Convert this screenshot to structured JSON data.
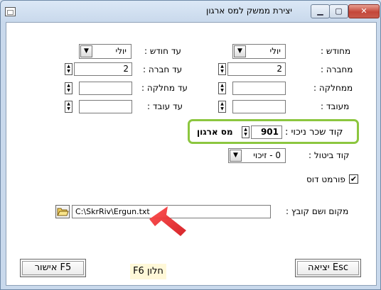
{
  "window": {
    "title": "יצירת ממשק למס ארגון",
    "min_glyph": "▁",
    "max_glyph": "▢",
    "close_glyph": "✕"
  },
  "form": {
    "from_month": {
      "label": "מחודש :",
      "value": "יולי"
    },
    "to_month": {
      "label": "עד חודש :",
      "value": "יולי"
    },
    "from_company": {
      "label": "מחברה :",
      "value": "2"
    },
    "to_company": {
      "label": "עד חברה :",
      "value": "2"
    },
    "from_department": {
      "label": "ממחלקה :",
      "value": ""
    },
    "to_department": {
      "label": "עד מחלקה :",
      "value": ""
    },
    "from_employee": {
      "label": "מעובד :",
      "value": ""
    },
    "to_employee": {
      "label": "עד עובד :",
      "value": ""
    },
    "deduction_code": {
      "label": "קוד שכר ניכוי :",
      "value": "901",
      "description": "מס ארגון"
    },
    "cancel_code": {
      "label": "קוד ביטול :",
      "value": "0 - זיכוי"
    },
    "dos_format": {
      "label": "פורמט דוס",
      "checked": true,
      "check_glyph": "✔"
    },
    "file_location": {
      "label": "מקום ושם קובץ :",
      "value": "C:\\SkrRiv\\Ergun.txt"
    }
  },
  "buttons": {
    "approve": "אישור F5",
    "exit": "יציאה Esc"
  },
  "hint": "F6 חלון",
  "colors": {
    "highlight": "#8cc63f",
    "arrow": "#e0262b"
  }
}
